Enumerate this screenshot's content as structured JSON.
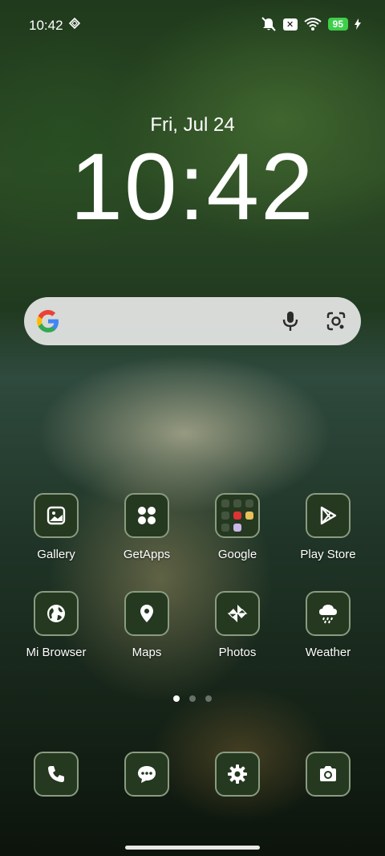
{
  "status": {
    "time": "10:42",
    "battery": "95"
  },
  "lockscreen": {
    "date": "Fri, Jul 24",
    "clock": "10:42"
  },
  "apps_row1": [
    {
      "label": "Gallery",
      "icon": "gallery-icon"
    },
    {
      "label": "GetApps",
      "icon": "getapps-icon"
    },
    {
      "label": "Google",
      "icon": "google-folder-icon"
    },
    {
      "label": "Play Store",
      "icon": "play-store-icon"
    }
  ],
  "apps_row2": [
    {
      "label": "Mi Browser",
      "icon": "globe-icon"
    },
    {
      "label": "Maps",
      "icon": "map-pin-icon"
    },
    {
      "label": "Photos",
      "icon": "pinwheel-icon"
    },
    {
      "label": "Weather",
      "icon": "cloud-rain-icon"
    }
  ],
  "dock": [
    {
      "icon": "phone-icon"
    },
    {
      "icon": "messages-icon"
    },
    {
      "icon": "settings-gear-icon"
    },
    {
      "icon": "camera-icon"
    }
  ],
  "pager": {
    "pages": 3,
    "active": 1
  }
}
